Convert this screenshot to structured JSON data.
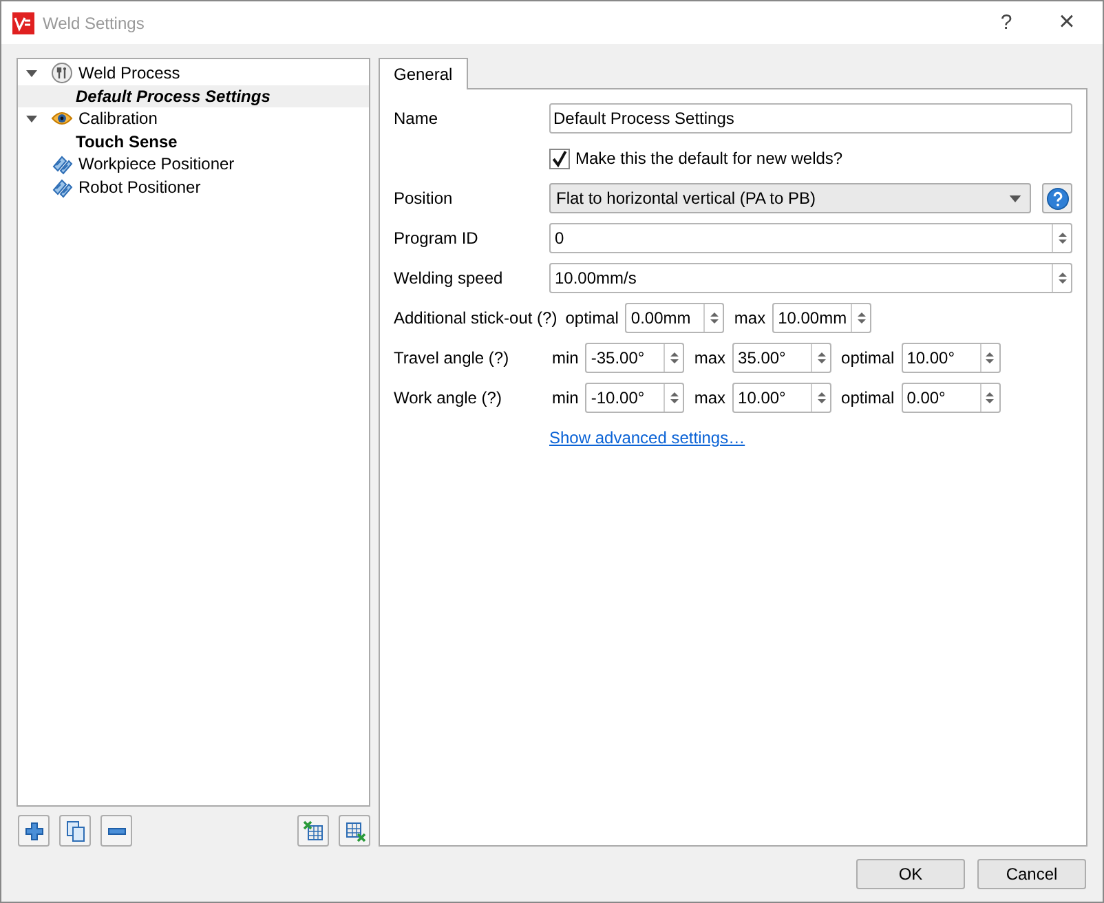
{
  "window": {
    "title": "Weld Settings",
    "help": "?",
    "close": "×"
  },
  "tree": [
    {
      "label": "Weld Process",
      "kind": "process",
      "expanded": true,
      "selected": false,
      "active": false,
      "is_default": false,
      "children": [
        {
          "label": "Default Process Settings",
          "selected": true,
          "active": true,
          "is_default": true
        }
      ]
    },
    {
      "label": "Calibration",
      "kind": "eye",
      "expanded": true,
      "selected": false,
      "active": false,
      "is_default": false,
      "children": [
        {
          "label": "Touch Sense",
          "selected": false,
          "active": true,
          "is_default": false
        }
      ]
    },
    {
      "label": "Workpiece Positioner",
      "kind": "positioner",
      "selected": false,
      "active": false,
      "is_default": false
    },
    {
      "label": "Robot Positioner",
      "kind": "positioner",
      "selected": false,
      "active": false,
      "is_default": false
    }
  ],
  "tree_buttons": [
    {
      "kind": "add"
    },
    {
      "kind": "copy"
    },
    {
      "kind": "remove"
    },
    {
      "kind": "import"
    },
    {
      "kind": "export"
    }
  ],
  "tabs": [
    {
      "label": "General",
      "selected": true
    }
  ],
  "form": [
    {
      "kind": "text",
      "label": "Name",
      "value": "Default Process Settings"
    },
    {
      "kind": "checkbox",
      "label": "Make this the default for new welds?",
      "checked": true
    },
    {
      "kind": "combo",
      "label": "Position",
      "value": "Flat to horizontal vertical (PA to PB)"
    },
    {
      "kind": "spin",
      "label": "Program ID",
      "value": "0"
    },
    {
      "kind": "spin",
      "label": "Welding speed",
      "value": "10.00mm/s"
    },
    {
      "kind": "multispin",
      "label": "Additional stick-out (?)",
      "parts": [
        {
          "prefix": "optimal",
          "value": "0.00mm"
        },
        {
          "prefix": "max",
          "value": "10.00mm"
        }
      ]
    },
    {
      "kind": "multispin",
      "label": "Travel angle (?)",
      "parts": [
        {
          "prefix": "min",
          "value": "-35.00°"
        },
        {
          "prefix": "max",
          "value": "35.00°"
        },
        {
          "prefix": "optimal",
          "value": "10.00°"
        }
      ]
    },
    {
      "kind": "multispin",
      "label": "Work angle (?)",
      "parts": [
        {
          "prefix": "min",
          "value": "-10.00°"
        },
        {
          "prefix": "max",
          "value": "10.00°"
        },
        {
          "prefix": "optimal",
          "value": "0.00°"
        }
      ]
    },
    {
      "kind": "link",
      "label": "Show advanced settings…"
    }
  ],
  "buttons": [
    "OK",
    "Cancel"
  ]
}
